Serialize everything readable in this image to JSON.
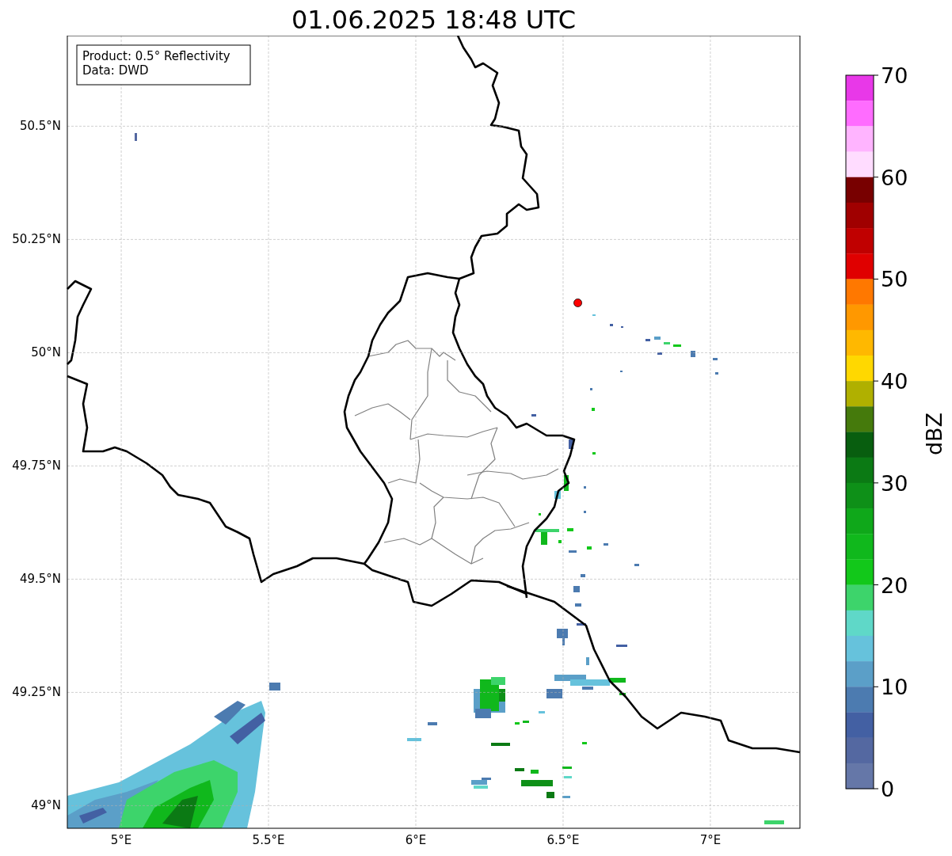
{
  "title": "01.06.2025 18:48 UTC",
  "info_box": {
    "lines": [
      "Product: 0.5° Reflectivity",
      "Data: DWD"
    ]
  },
  "map": {
    "chart_data": {
      "type": "scatter",
      "grid": true,
      "xlim": [
        4.817,
        7.304
      ],
      "ylim": [
        48.95,
        50.7
      ],
      "xticks": [
        {
          "value": 5,
          "label": "5°E"
        },
        {
          "value": 5.5,
          "label": "5.5°E"
        },
        {
          "value": 6,
          "label": "6°E"
        },
        {
          "value": 6.5,
          "label": "6.5°E"
        },
        {
          "value": 7,
          "label": "7°E"
        }
      ],
      "yticks": [
        {
          "value": 49,
          "label": "49°N"
        },
        {
          "value": 49.25,
          "label": "49.25°N"
        },
        {
          "value": 49.5,
          "label": "49.5°N"
        },
        {
          "value": 49.75,
          "label": "49.75°N"
        },
        {
          "value": 50,
          "label": "50°N"
        },
        {
          "value": 50.25,
          "label": "50.25°N"
        },
        {
          "value": 50.5,
          "label": "50.5°N"
        }
      ],
      "x": [
        6.55
      ],
      "series": [
        {
          "color": "#ff0000",
          "values": [
            50.11
          ]
        }
      ]
    }
  },
  "colorbar": {
    "label": "dBZ",
    "ticks": [
      "70",
      "60",
      "50",
      "40",
      "30",
      "20",
      "10",
      "0"
    ],
    "segments": [
      {
        "color": "#e838e8"
      },
      {
        "color": "#ff6cff"
      },
      {
        "color": "#ffb4ff"
      },
      {
        "color": "#ffdcff"
      },
      {
        "color": "#780000"
      },
      {
        "color": "#a00000"
      },
      {
        "color": "#c00000"
      },
      {
        "color": "#e00000"
      },
      {
        "color": "#ff7800"
      },
      {
        "color": "#ff9800"
      },
      {
        "color": "#ffb800"
      },
      {
        "color": "#ffd800"
      },
      {
        "color": "#b0b000"
      },
      {
        "color": "#457a0c"
      },
      {
        "color": "#085e0f"
      },
      {
        "color": "#0b7a14"
      },
      {
        "color": "#0e9018"
      },
      {
        "color": "#0fa81a"
      },
      {
        "color": "#10b81c"
      },
      {
        "color": "#12c81a"
      },
      {
        "color": "#3dd46b"
      },
      {
        "color": "#5fd8c8"
      },
      {
        "color": "#66c2dc"
      },
      {
        "color": "#5b9fc8"
      },
      {
        "color": "#4c7bb0"
      },
      {
        "color": "#4360a3"
      },
      {
        "color": "#5468a1"
      },
      {
        "color": "#6577a8"
      }
    ]
  }
}
